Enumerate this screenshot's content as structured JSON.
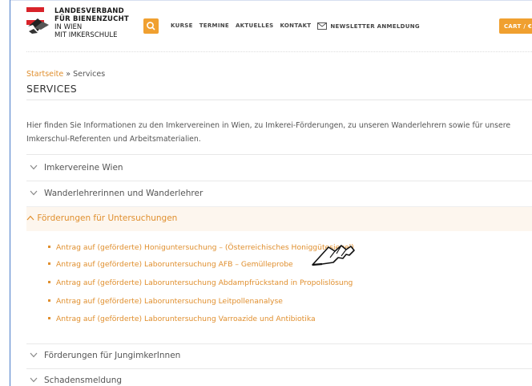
{
  "header": {
    "logo_lines": [
      "LANDESVERBAND",
      "FÜR BIENENZUCHT",
      "IN WIEN",
      "MIT IMKERSCHULE"
    ],
    "nav": [
      "KURSE",
      "TERMINE",
      "AKTUELLES",
      "KONTAKT",
      "NEWSLETTER ANMELDUNG"
    ],
    "cart_label": "CART / €",
    "accent_color": "#f0a030"
  },
  "breadcrumb": {
    "home": "Startseite",
    "separator": " » ",
    "current": "Services"
  },
  "page_title": "SERVICES",
  "intro": "Hier finden Sie Informationen zu den Imkervereinen in Wien, zu Imkerei-Förderungen, zu unseren Wanderlehrern sowie für unsere Imkerschul-Referenten und Arbeitsmaterialien.",
  "accordion": [
    {
      "label": "Imkervereine Wien",
      "expanded": false
    },
    {
      "label": "Wanderlehrerinnen und Wanderlehrer",
      "expanded": false
    },
    {
      "label": "Förderungen für Untersuchungen",
      "expanded": true
    },
    {
      "label": "Förderungen für JungimkerInnen",
      "expanded": false
    },
    {
      "label": "Schadensmeldung",
      "expanded": false
    }
  ],
  "open_items": [
    "Antrag auf (geförderte) Honiguntersuchung – (Österreichisches Honiggütesiegel)",
    "Antrag auf (geförderte) Laboruntersuchung AFB – Gemülleprobe",
    "Antrag auf (geförderte) Laboruntersuchung Abdampfrückstand in Propolislösung",
    "Antrag auf (geförderte) Laboruntersuchung Leitpollenanalyse",
    "Antrag auf (geförderte) Laboruntersuchung Varroazide und Antibiotika"
  ]
}
